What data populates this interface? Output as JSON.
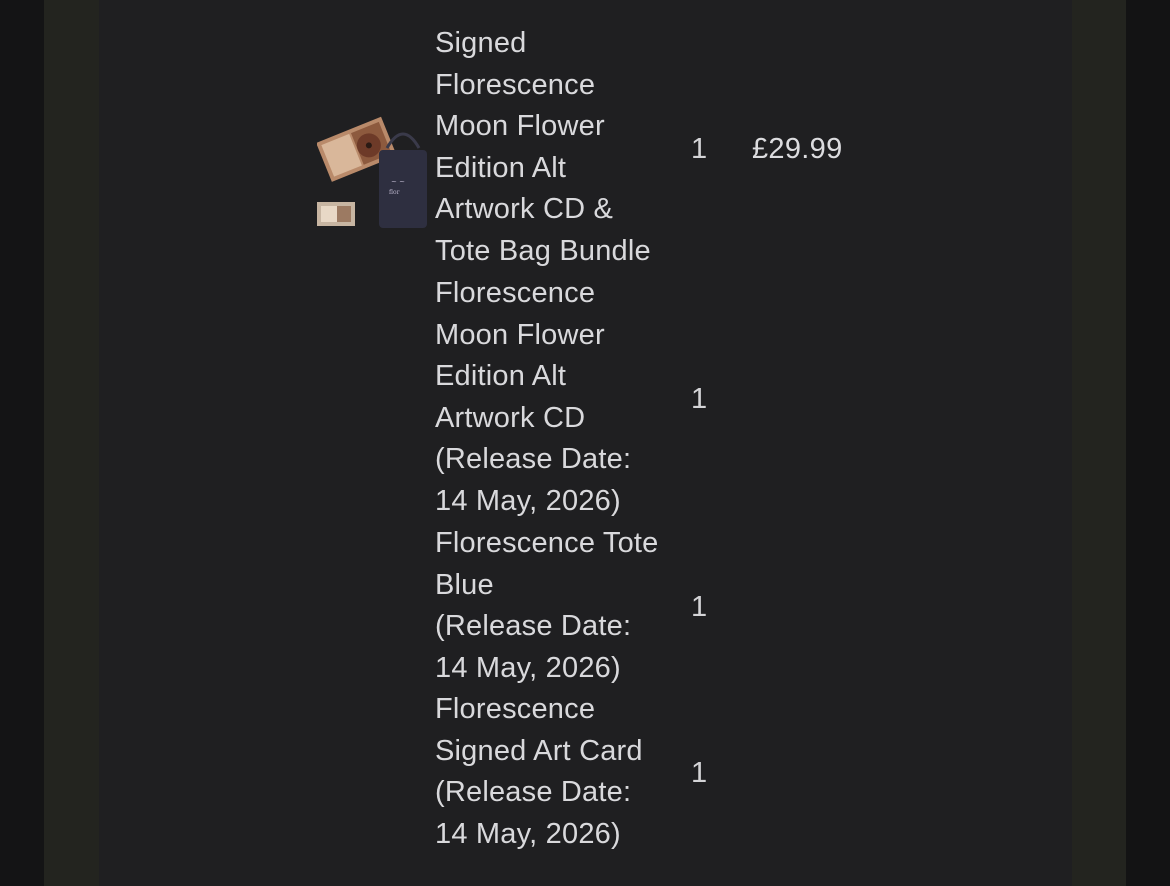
{
  "order": {
    "items": [
      {
        "name_lines": [
          "Signed",
          "Florescence",
          "Moon Flower",
          "Edition Alt",
          "Artwork CD &",
          "Tote Bag Bundle"
        ],
        "qty": "1",
        "price": "£29.99",
        "thumbnail": "product-bundle-thumbnail"
      },
      {
        "name_lines": [
          "Florescence",
          "Moon Flower",
          "Edition Alt",
          "Artwork CD",
          "(Release Date:",
          "14 May, 2026)"
        ],
        "qty": "1"
      },
      {
        "name_lines": [
          "Florescence Tote",
          "Blue",
          "(Release Date:",
          "14 May, 2026)"
        ],
        "qty": "1"
      },
      {
        "name_lines": [
          "Florescence",
          "Signed Art Card",
          "(Release Date:",
          "14 May, 2026)"
        ],
        "qty": "1"
      }
    ]
  },
  "colors": {
    "page_bg": "#101011",
    "frame": "#23241f",
    "panel": "#1f1f21",
    "text": "#d9d9dc"
  }
}
